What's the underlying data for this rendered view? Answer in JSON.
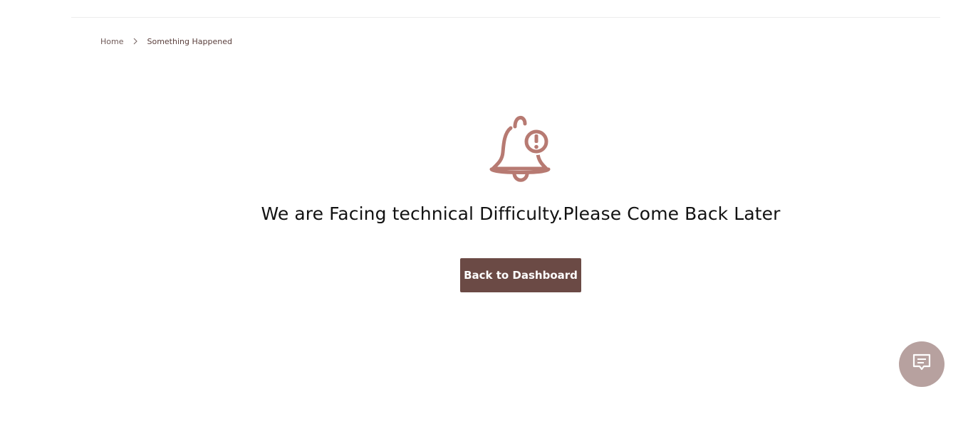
{
  "breadcrumb": {
    "home": "Home",
    "current": "Something Happened",
    "separator_icon": "chevron-right-icon"
  },
  "illustration": {
    "icon": "bell-alert-icon",
    "color": "#b77a72"
  },
  "main": {
    "message": "We are Facing technical Difficulty.Please Come Back Later",
    "button_label": "Back to Dashboard"
  },
  "chat": {
    "icon": "chat-message-icon",
    "color": "#b7a19f"
  },
  "colors": {
    "primary_button": "#6b4a45",
    "accent": "#b77a72"
  }
}
